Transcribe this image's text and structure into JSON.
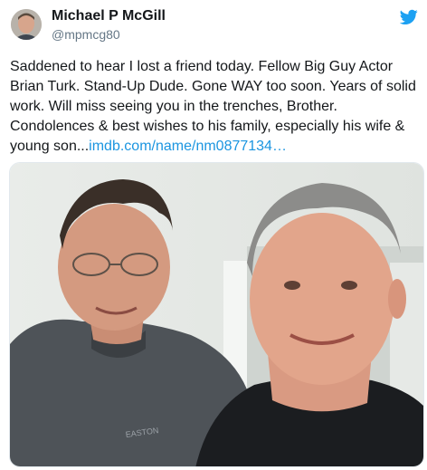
{
  "author": {
    "display_name": "Michael P McGill",
    "handle": "@mpmcg80",
    "avatar_icon": "profile-avatar"
  },
  "tweet": {
    "text": "Saddened to hear I lost a friend today.  Fellow Big Guy Actor Brian Turk.  Stand-Up Dude.  Gone WAY too soon.  Years of solid work.  Will miss seeing you in the trenches, Brother. Condolences & best wishes to his family, especially his wife & young son...",
    "link_text": "imdb.com/name/nm0877134…"
  },
  "photo": {
    "shirt_logo": "EASTON"
  },
  "icons": {
    "platform": "twitter-bird-icon"
  },
  "colors": {
    "link": "#1b95e0",
    "handle": "#657786",
    "bird": "#1da1f2"
  }
}
